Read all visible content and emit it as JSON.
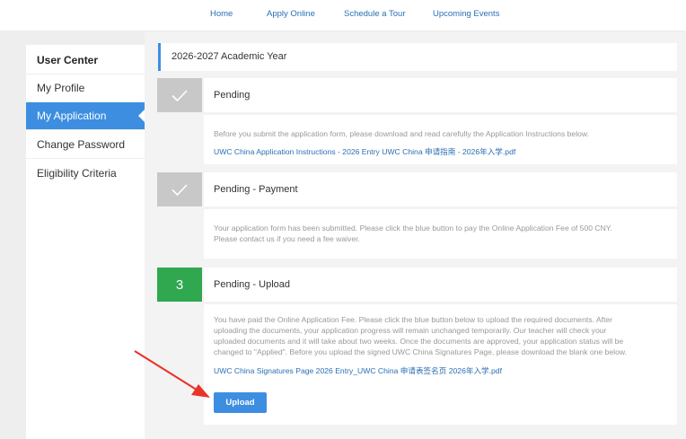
{
  "nav": {
    "items": [
      "Home",
      "Apply Online",
      "Schedule a Tour",
      "Upcoming Events"
    ]
  },
  "sidebar": {
    "title": "User Center",
    "items": [
      "My Profile",
      "My Application",
      "Change Password",
      "Eligibility Criteria"
    ],
    "active": "My Application"
  },
  "main": {
    "year": "2026-2027 Academic Year",
    "steps": [
      {
        "marker": "check-icon",
        "title": "Pending",
        "body": "Before you submit the application form, please download and read carefully the Application Instructions below.",
        "link": "UWC China Application Instructions - 2026 Entry UWC China 申请指南 - 2026年入学.pdf"
      },
      {
        "marker": "check-icon",
        "title": "Pending - Payment",
        "body_line1": "Your application form has been submitted. Please click the blue button to pay the Online Application Fee of 500 CNY.",
        "body_line2": "Please contact us if you need a fee waiver."
      },
      {
        "marker": "3",
        "title": "Pending - Upload",
        "body_lines": [
          "You have paid the Online Application Fee. Please click the blue button below to upload the required documents. After",
          "uploading the documents, your application progress will remain unchanged temporarily. Our teacher will check your",
          "uploaded documents and it will take about two weeks. Once the documents are approved, your application status will be",
          "changed to \"Applied\". Before you upload the signed UWC China Signatures Page, please download the blank one below."
        ],
        "link": "UWC China Signatures Page 2026 Entry_UWC China 申请表签名页 2026年入学.pdf",
        "button": "Upload"
      }
    ]
  },
  "colors": {
    "accent": "#3d8ee0",
    "link": "#2a6fb5",
    "done": "#c8c8c8",
    "current": "#2fa84f",
    "arrow": "#e8352a"
  }
}
